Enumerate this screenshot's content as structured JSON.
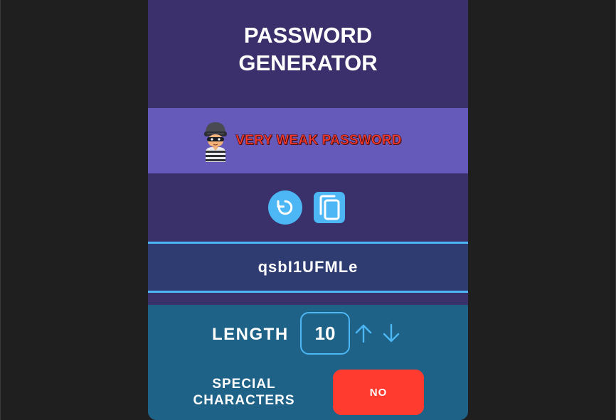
{
  "app": {
    "title_line1": "PASSWORD",
    "title_line2": "GENERATOR"
  },
  "strength": {
    "label": "VERY WEAK PASSWORD",
    "avatar_icon": "robber-avatar-icon",
    "color": "#ff3b30"
  },
  "actions": {
    "refresh_icon": "refresh-icon",
    "copy_icon": "copy-icon",
    "accent": "#4db6f5"
  },
  "password": {
    "value": "qsbI1UFMLe"
  },
  "settings": {
    "length_label": "LENGTH",
    "length_value": "10",
    "increase_icon": "arrow-up-icon",
    "decrease_icon": "arrow-down-icon",
    "special_label_line1": "SPECIAL",
    "special_label_line2": "CHARACTERS",
    "special_value": "NO",
    "special_color": "#ff3b30"
  }
}
